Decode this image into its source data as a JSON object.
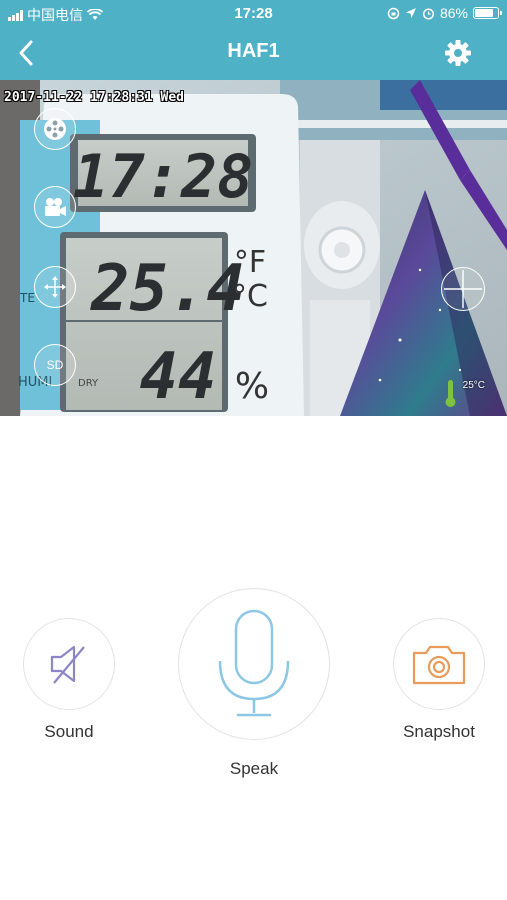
{
  "status_bar": {
    "carrier": "中国电信",
    "time": "17:28",
    "battery_percent": "86%",
    "battery_level": 0.86
  },
  "nav": {
    "title": "HAF1",
    "back_icon": "chevron-left-icon",
    "settings_icon": "gear-icon"
  },
  "video": {
    "osd_timestamp": "2017-11-22 17:28:31 Wed",
    "temperature_overlay": "25°C",
    "side_buttons": [
      {
        "icon": "film-reel-icon"
      },
      {
        "icon": "video-camera-icon"
      },
      {
        "icon": "move-arrows-icon"
      },
      {
        "icon": "sd-card-icon",
        "label": "SD"
      }
    ],
    "ptz_icon": "crosshair-icon"
  },
  "controls": {
    "sound_label": "Sound",
    "speak_label": "Speak",
    "snapshot_label": "Snapshot"
  },
  "colors": {
    "header": "#4fb1c6",
    "mic_blue": "#8cc7e6",
    "sound_purple": "#8d86c6",
    "snapshot_orange": "#e89b5a"
  }
}
